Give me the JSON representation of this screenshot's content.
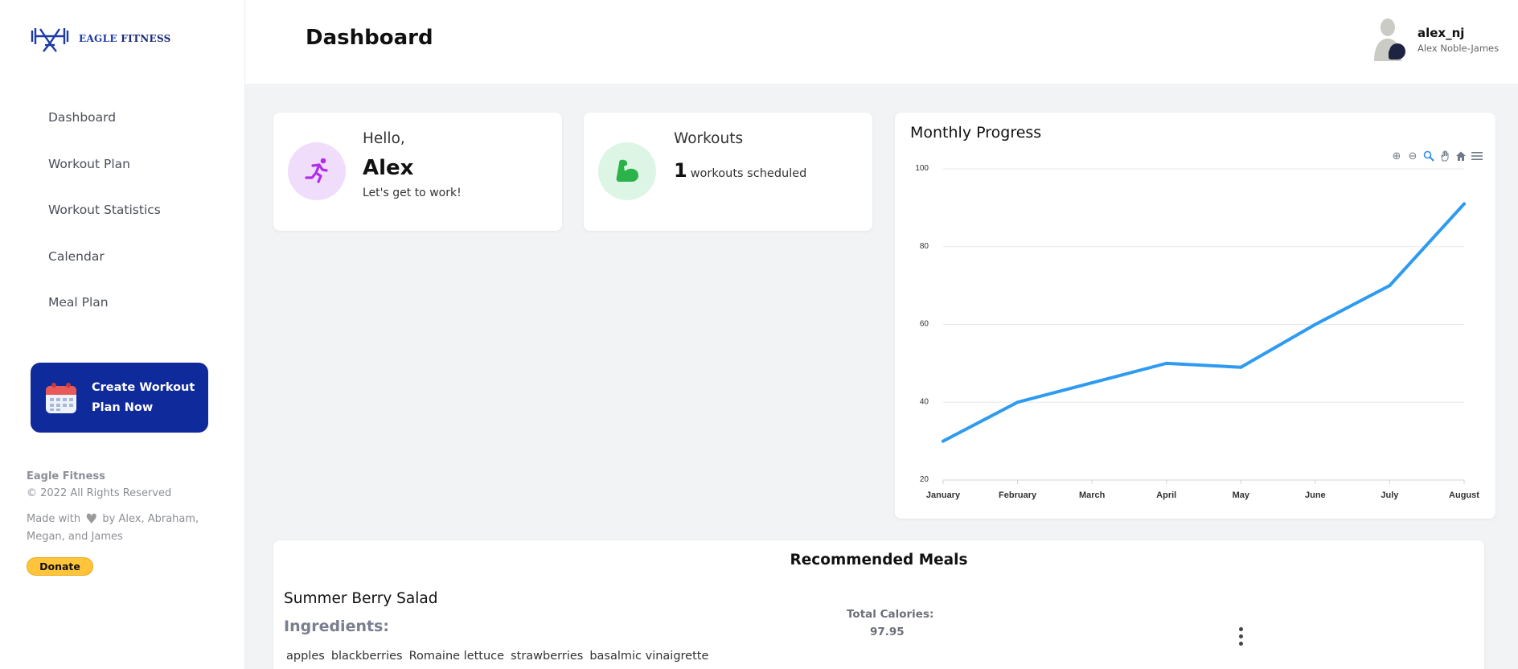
{
  "brand": {
    "logo_word1": "EAGLE",
    "logo_word2": "FITNESS"
  },
  "sidebar": {
    "items": [
      {
        "label": "Dashboard"
      },
      {
        "label": "Workout Plan"
      },
      {
        "label": "Workout Statistics"
      },
      {
        "label": "Calendar"
      },
      {
        "label": "Meal Plan"
      }
    ],
    "cta_label": "Create Workout Plan Now"
  },
  "footer": {
    "brand": "Eagle Fitness",
    "copyright": "© 2022 All Rights Reserved",
    "made_prefix": "Made with",
    "made_suffix": "by Alex, Abraham, Megan, and James",
    "donate_label": "Donate"
  },
  "header": {
    "title": "Dashboard",
    "username": "alex_nj",
    "fullname": "Alex Noble-James"
  },
  "hello_card": {
    "greeting": "Hello,",
    "name": "Alex",
    "subtitle": "Let's get to work!"
  },
  "workouts_card": {
    "title": "Workouts",
    "count": "1",
    "suffix": "workouts scheduled"
  },
  "chart": {
    "title": "Monthly Progress"
  },
  "chart_data": {
    "type": "line",
    "title": "Monthly Progress",
    "categories": [
      "January",
      "February",
      "March",
      "April",
      "May",
      "June",
      "July",
      "August"
    ],
    "series": [
      {
        "values": [
          30,
          40,
          45,
          50,
          49,
          60,
          70,
          91
        ]
      }
    ],
    "yticks": [
      "20",
      "40",
      "60",
      "80",
      "100"
    ],
    "ylim": [
      20,
      100
    ],
    "grid": true,
    "color": "#2e9bf0"
  },
  "meals": {
    "title": "Recommended Meals",
    "meal_name": "Summer Berry Salad",
    "ingredients_label": "Ingredients:",
    "ingredients": [
      "apples",
      "blackberries",
      "Romaine lettuce",
      "strawberries",
      "basalmic vinaigrette"
    ],
    "calories_label": "Total Calories:",
    "calories_value": "97.95"
  },
  "colors": {
    "accent": "#0f2a9a",
    "chart_line": "#2e9bf0"
  }
}
